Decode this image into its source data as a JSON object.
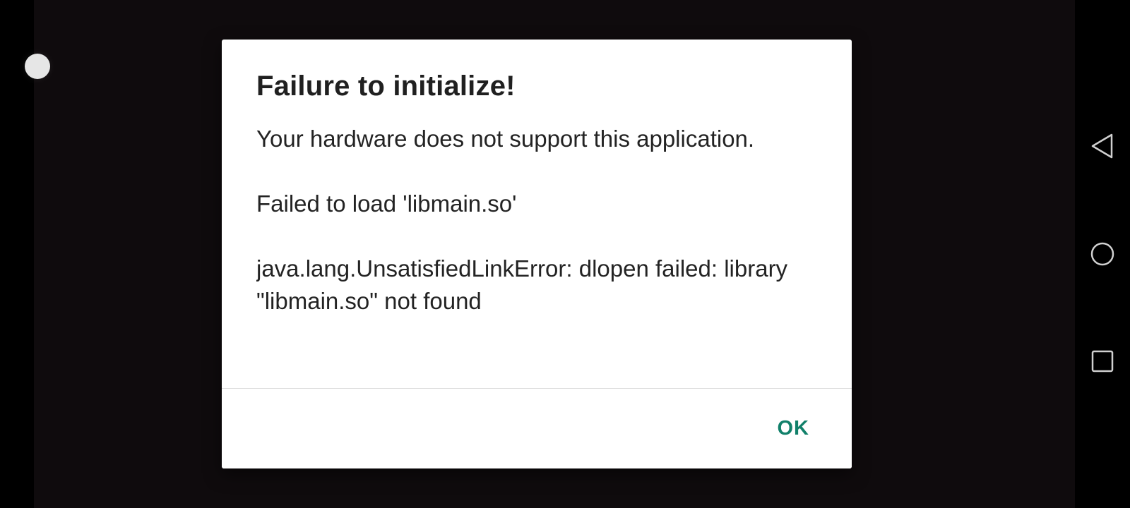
{
  "dialog": {
    "title": "Failure to initialize!",
    "message_1": "Your hardware does not support this application.",
    "message_2": "Failed to load 'libmain.so'",
    "message_3": "java.lang.UnsatisfiedLinkError: dlopen failed: library \"libmain.so\" not found",
    "ok_label": "OK"
  },
  "colors": {
    "background": "#0f0b0d",
    "dialog": "#ffffff",
    "accent": "#11806a",
    "text": "#232323"
  },
  "icons": {
    "floating_dot": "circle-dot-icon",
    "nav_back": "back-triangle-icon",
    "nav_home": "home-circle-icon",
    "nav_recent": "recent-square-icon"
  }
}
